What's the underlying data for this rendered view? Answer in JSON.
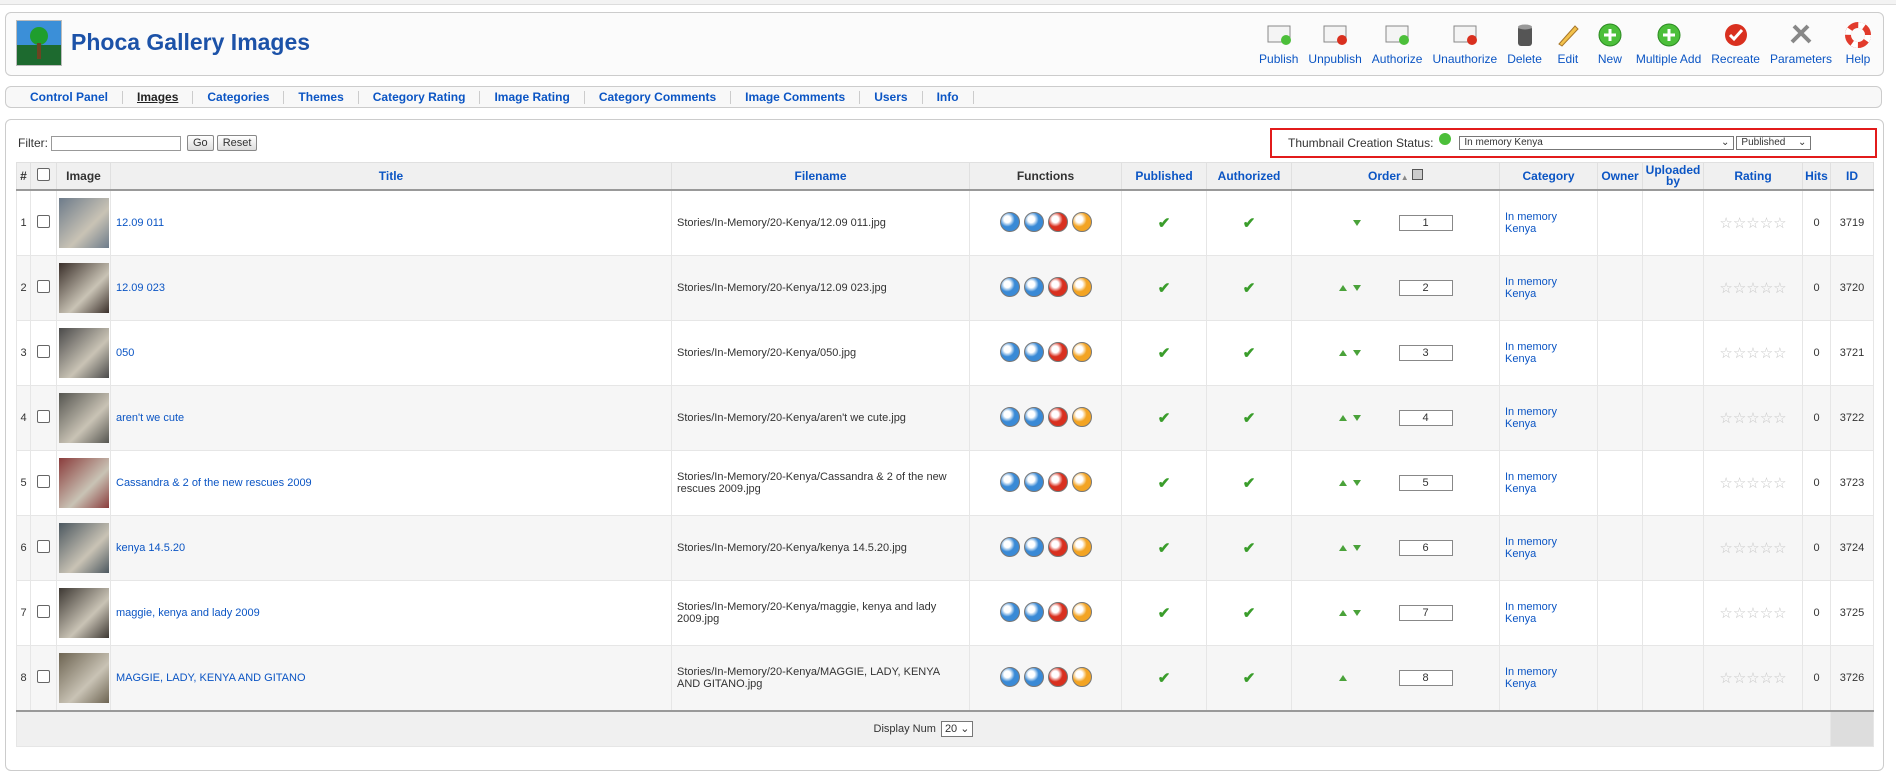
{
  "header": {
    "title": "Phoca Gallery Images",
    "toolbar": [
      {
        "label": "Publish",
        "icon": "publish-icon",
        "color": "#e3e3e3"
      },
      {
        "label": "Unpublish",
        "icon": "unpublish-icon",
        "color": "#e3e3e3"
      },
      {
        "label": "Authorize",
        "icon": "authorize-icon",
        "color": "#e3e3e3"
      },
      {
        "label": "Unauthorize",
        "icon": "unauthorize-icon",
        "color": "#e3e3e3"
      },
      {
        "label": "Delete",
        "icon": "trash-icon",
        "color": "#555555"
      },
      {
        "label": "Edit",
        "icon": "pencil-icon",
        "color": "#f3c24c"
      },
      {
        "label": "New",
        "icon": "plus-icon",
        "color": "#4cbf3a"
      },
      {
        "label": "Multiple Add",
        "icon": "plus-multiple-icon",
        "color": "#4cbf3a"
      },
      {
        "label": "Recreate",
        "icon": "recreate-check-icon",
        "color": "#d9301f"
      },
      {
        "label": "Parameters",
        "icon": "gear-tools-icon",
        "color": "#b0b0b0"
      },
      {
        "label": "Help",
        "icon": "lifebuoy-icon",
        "color": "#e23b2c"
      }
    ]
  },
  "submenu": [
    {
      "label": "Control Panel",
      "active": false
    },
    {
      "label": "Images",
      "active": true
    },
    {
      "label": "Categories",
      "active": false
    },
    {
      "label": "Themes",
      "active": false
    },
    {
      "label": "Category Rating",
      "active": false
    },
    {
      "label": "Image Rating",
      "active": false
    },
    {
      "label": "Category Comments",
      "active": false
    },
    {
      "label": "Image Comments",
      "active": false
    },
    {
      "label": "Users",
      "active": false
    },
    {
      "label": "Info",
      "active": false
    }
  ],
  "filter": {
    "label": "Filter:",
    "value": "",
    "go_label": "Go",
    "reset_label": "Reset"
  },
  "status": {
    "label": "Thumbnail Creation Status:",
    "category_select": "In memory Kenya",
    "state_select": "Published",
    "ok_color": "#4cbf3a"
  },
  "columns": {
    "num": "#",
    "image": "Image",
    "title": "Title",
    "filename": "Filename",
    "functions": "Functions",
    "published": "Published",
    "authorized": "Authorized",
    "order": "Order",
    "category": "Category",
    "owner": "Owner",
    "uploaded_by": "Uploaded by",
    "rating": "Rating",
    "hits": "Hits",
    "id": "ID"
  },
  "rows": [
    {
      "num": "1",
      "title": "12.09 011",
      "filename": "Stories/In-Memory/20-Kenya/12.09 011.jpg",
      "order": "1",
      "category": "In memory Kenya",
      "hits": "0",
      "id": "3719",
      "up": false,
      "down": true,
      "thumb": "#6d7b8a"
    },
    {
      "num": "2",
      "title": "12.09 023",
      "filename": "Stories/In-Memory/20-Kenya/12.09 023.jpg",
      "order": "2",
      "category": "In memory Kenya",
      "hits": "0",
      "id": "3720",
      "up": true,
      "down": true,
      "thumb": "#3a2f2a"
    },
    {
      "num": "3",
      "title": "050",
      "filename": "Stories/In-Memory/20-Kenya/050.jpg",
      "order": "3",
      "category": "In memory Kenya",
      "hits": "0",
      "id": "3721",
      "up": true,
      "down": true,
      "thumb": "#4a4a4a"
    },
    {
      "num": "4",
      "title": "aren't we cute",
      "filename": "Stories/In-Memory/20-Kenya/aren't we cute.jpg",
      "order": "4",
      "category": "In memory Kenya",
      "hits": "0",
      "id": "3722",
      "up": true,
      "down": true,
      "thumb": "#555550"
    },
    {
      "num": "5",
      "title": "Cassandra & 2 of the new rescues 2009",
      "filename": "Stories/In-Memory/20-Kenya/Cassandra & 2 of the new rescues 2009.jpg",
      "order": "5",
      "category": "In memory Kenya",
      "hits": "0",
      "id": "3723",
      "up": true,
      "down": true,
      "thumb": "#8a3c3c"
    },
    {
      "num": "6",
      "title": "kenya 14.5.20",
      "filename": "Stories/In-Memory/20-Kenya/kenya 14.5.20.jpg",
      "order": "6",
      "category": "In memory Kenya",
      "hits": "0",
      "id": "3724",
      "up": true,
      "down": true,
      "thumb": "#4c5860"
    },
    {
      "num": "7",
      "title": "maggie, kenya and lady 2009",
      "filename": "Stories/In-Memory/20-Kenya/maggie, kenya and lady 2009.jpg",
      "order": "7",
      "category": "In memory Kenya",
      "hits": "0",
      "id": "3725",
      "up": true,
      "down": true,
      "thumb": "#3d3833"
    },
    {
      "num": "8",
      "title": "MAGGIE, LADY, KENYA AND GITANO",
      "filename": "Stories/In-Memory/20-Kenya/MAGGIE, LADY, KENYA AND GITANO.jpg",
      "order": "8",
      "category": "In memory Kenya",
      "hits": "0",
      "id": "3726",
      "up": true,
      "down": false,
      "thumb": "#6d6452"
    }
  ],
  "footer": {
    "display_label": "Display Num",
    "display_value": "20"
  }
}
